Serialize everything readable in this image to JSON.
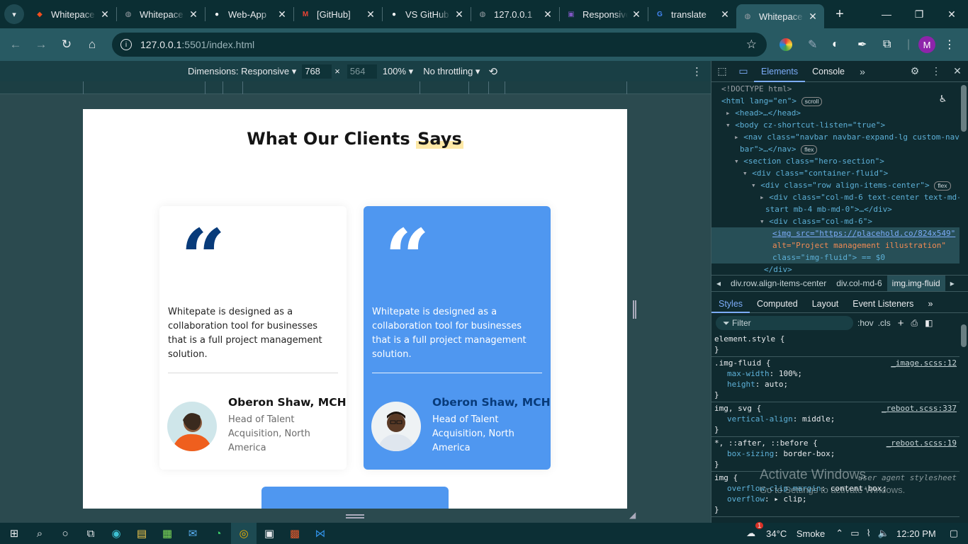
{
  "tabs": [
    {
      "title": "Whitepace",
      "icon": "figma-icon",
      "color": "#f24e1e"
    },
    {
      "title": "Whitepace",
      "icon": "globe-icon",
      "color": "#9aa0a6"
    },
    {
      "title": "Web-App",
      "icon": "github-icon",
      "color": "#ffffff"
    },
    {
      "title": "[GitHub]",
      "icon": "gmail-icon",
      "color": "#ea4335"
    },
    {
      "title": "VS GitHub",
      "icon": "github-icon",
      "color": "#ffffff"
    },
    {
      "title": "127.0.0.1",
      "icon": "globe-icon",
      "color": "#9aa0a6"
    },
    {
      "title": "Responsive",
      "icon": "responsive-icon",
      "color": "#7e57c2"
    },
    {
      "title": "translate",
      "icon": "google-icon",
      "color": "#4285f4"
    },
    {
      "title": "Whitepace",
      "icon": "globe-icon",
      "color": "#9aa0a6",
      "active": true
    }
  ],
  "address": {
    "host": "127.0.0.1",
    "rest": ":5501/index.html"
  },
  "profile_initial": "M",
  "device_toolbar": {
    "dimensions_label": "Dimensions: Responsive",
    "width": "768",
    "height": "564",
    "zoom": "100%",
    "throttle": "No throttling"
  },
  "page": {
    "title_plain": "What Our Clients",
    "title_highlight": "Says",
    "cards": [
      {
        "quote_mark": "“",
        "text": "Whitepate is designed as a collaboration tool for businesses that is a full project management solution.",
        "name": "Oberon Shaw, MCH",
        "role": "Head of Talent Acquisition, North America",
        "style": "white"
      },
      {
        "quote_mark": "“",
        "text": "Whitepate is designed as a collaboration tool for businesses that is a full project management solution.",
        "name": "Oberon Shaw, MCH",
        "role": "Head of Talent Acquisition, North America",
        "style": "blue"
      }
    ]
  },
  "devtools": {
    "tabs": [
      "Elements",
      "Console"
    ],
    "dom_lines": [
      "<!DOCTYPE html>",
      "<html lang=\"en\">",
      "<head>…</head>",
      "<body cz-shortcut-listen=\"true\">",
      "<nav class=\"navbar navbar-expand-lg custom-nav",
      "bar\">…</nav>",
      "<section class=\"hero-section\">",
      "<div class=\"container-fluid\">",
      "<div class=\"row align-items-center\">",
      "<div class=\"col-md-6 text-center text-md-",
      "start mb-4 mb-md-0\">…</div>",
      "<div class=\"col-md-6\">",
      "<img src=\"https://placehold.co/824x549\"",
      "alt=\"Project management illustration\"",
      "class=\"img-fluid\"> == $0",
      "</div>"
    ],
    "badges": {
      "scroll": "scroll",
      "flex": "flex"
    },
    "breadcrumb": [
      "div.row.align-items-center",
      "div.col-md-6",
      "img.img-fluid"
    ],
    "style_tabs": [
      "Styles",
      "Computed",
      "Layout",
      "Event Listeners"
    ],
    "filter_placeholder": "Filter",
    "filter_tools": [
      ":hov",
      ".cls"
    ],
    "rules": [
      {
        "selector": "element.style {",
        "source": "",
        "props": [],
        "close": "}"
      },
      {
        "selector": ".img-fluid {",
        "source": "_image.scss:12",
        "props": [
          [
            "max-width",
            "100%;"
          ],
          [
            "height",
            "auto;"
          ]
        ],
        "close": "}"
      },
      {
        "selector": "img, svg {",
        "source": "_reboot.scss:337",
        "props": [
          [
            "vertical-align",
            "middle;"
          ]
        ],
        "close": "}"
      },
      {
        "selector": "*, ::after, ::before {",
        "source": "_reboot.scss:19",
        "props": [
          [
            "box-sizing",
            "border-box;"
          ]
        ],
        "close": "}"
      },
      {
        "selector": "img {",
        "source": "user agent stylesheet",
        "props": [
          [
            "overflow-clip-margin",
            "content-box;"
          ],
          [
            "overflow",
            "▸ clip;"
          ]
        ],
        "close": "}"
      }
    ]
  },
  "watermark": {
    "title": "Activate Windows",
    "subtitle": "Go to Settings to activate Windows."
  },
  "taskbar": {
    "temp": "34°C",
    "weather": "Smoke",
    "time": "12:20 PM",
    "badge": "1"
  }
}
